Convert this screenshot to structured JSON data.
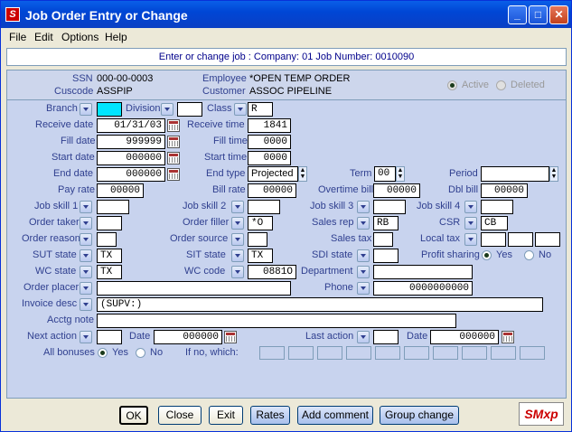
{
  "window": {
    "title": "Job Order Entry or Change",
    "app_icon": "app-logo-icon"
  },
  "menu": [
    "File",
    "Edit",
    "Options",
    "Help"
  ],
  "info_bar": "Enter or change job :  Company:  01   Job Number:  0010090",
  "header": {
    "ssn_label": "SSN",
    "ssn": "000-00-0003",
    "cuscode_label": "Cuscode",
    "cuscode": "ASSPIP",
    "employee_label": "Employee",
    "employee": "*OPEN TEMP ORDER",
    "customer_label": "Customer",
    "customer": "ASSOC PIPELINE",
    "active_label": "Active",
    "deleted_label": "Deleted"
  },
  "labels": {
    "branch": "Branch",
    "division": "Division",
    "class": "Class",
    "receive_date": "Receive date",
    "receive_time": "Receive time",
    "fill_date": "Fill date",
    "fill_time": "Fill time",
    "start_date": "Start date",
    "start_time": "Start time",
    "end_date": "End date",
    "end_type": "End type",
    "term": "Term",
    "period": "Period",
    "pay_rate": "Pay rate",
    "bill_rate": "Bill rate",
    "overtime_bill": "Overtime bill",
    "dbl_bill": "Dbl bill",
    "job_skill_1": "Job skill 1",
    "job_skill_2": "Job skill 2",
    "job_skill_3": "Job skill 3",
    "job_skill_4": "Job skill 4",
    "order_taker": "Order taker",
    "order_filler": "Order filler",
    "sales_rep": "Sales rep",
    "csr": "CSR",
    "order_reason": "Order reason",
    "order_source": "Order source",
    "sales_tax": "Sales tax",
    "local_tax": "Local tax",
    "sut_state": "SUT state",
    "sit_state": "SIT state",
    "sdi_state": "SDI state",
    "profit_sharing": "Profit sharing",
    "wc_state": "WC state",
    "wc_code": "WC code",
    "department": "Department",
    "order_placer": "Order placer",
    "phone": "Phone",
    "invoice_desc": "Invoice desc",
    "acctg_note": "Acctg note",
    "next_action": "Next action",
    "date": "Date",
    "last_action": "Last action",
    "all_bonuses": "All bonuses",
    "if_no_which": "If no, which:",
    "yes": "Yes",
    "no": "No"
  },
  "values": {
    "branch": "",
    "division": "",
    "class": "R",
    "receive_date": "01/31/03",
    "receive_time": "1841",
    "fill_date": "999999",
    "fill_time": "0000",
    "start_date": "000000",
    "start_time": "0000",
    "end_date": "000000",
    "end_type": "Projected",
    "term": "00",
    "period": "",
    "pay_rate": "00000",
    "bill_rate": "00000",
    "overtime_bill": "00000",
    "dbl_bill": "00000",
    "order_filler": "*O",
    "sales_rep": "RB",
    "csr": "CB",
    "sut_state": "TX",
    "sit_state": "TX",
    "wc_state": "TX",
    "wc_code": "0881O",
    "phone": "0000000000",
    "invoice_desc": "(SUPV:)",
    "next_action_date": "000000",
    "last_action_date": "000000"
  },
  "buttons": {
    "ok": "OK",
    "close": "Close",
    "exit": "Exit",
    "rates": "Rates",
    "add_comment": "Add comment",
    "group_change": "Group change"
  },
  "logo_text": "SMxp"
}
